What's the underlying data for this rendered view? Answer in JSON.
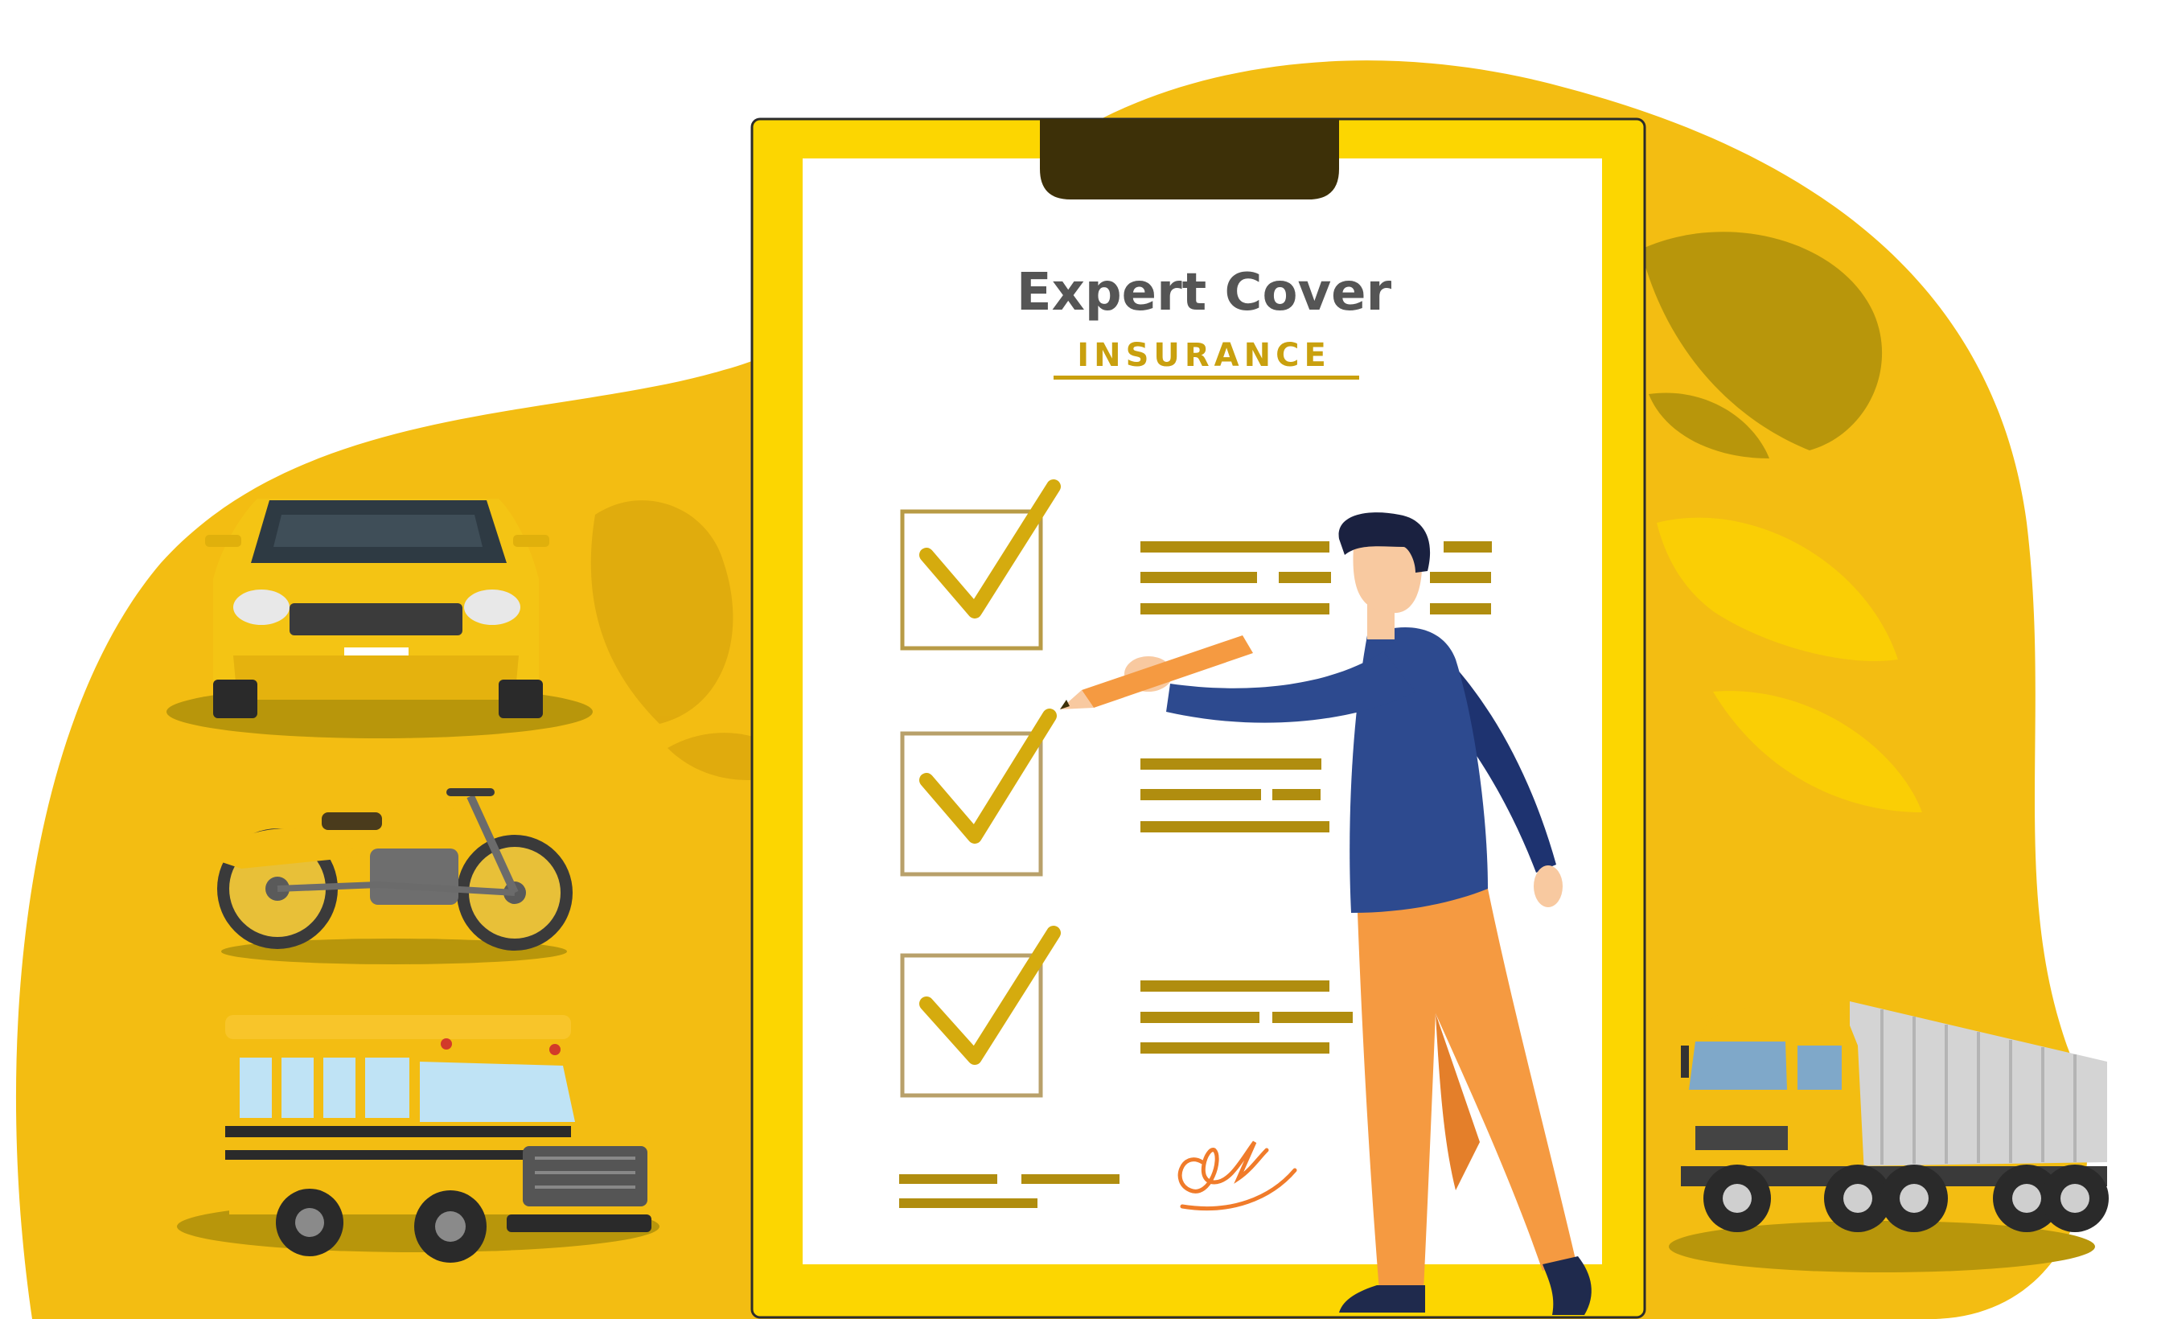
{
  "document": {
    "title": "Expert Cover",
    "subtitle": "INSURANCE"
  },
  "checklist": {
    "items": [
      {
        "checked": true
      },
      {
        "checked": true
      },
      {
        "checked": true
      }
    ]
  },
  "colors": {
    "background_blob": "#f3bd12",
    "leaf_shadow": "#b8960b",
    "clipboard_frame": "#fcd601",
    "clipboard_clip": "#3d3008",
    "paper": "#ffffff",
    "title_gray": "#555555",
    "accent_gold": "#c9a00e",
    "checkbox_stroke": "#b8a06a",
    "check_mark": "#d5ab0e",
    "text_lines": "#b08d0f",
    "signature_orange": "#f07b2a",
    "shirt_blue": "#2d4a8f",
    "pants_orange": "#f59a41",
    "skin": "#f8c9a0",
    "hair": "#1a2140"
  },
  "vehicles": [
    {
      "icon": "car-icon"
    },
    {
      "icon": "motorcycle-icon"
    },
    {
      "icon": "school-bus-icon"
    },
    {
      "icon": "truck-icon"
    }
  ],
  "figure": {
    "icon": "person-writing-icon"
  },
  "signature": {
    "icon": "signature-icon"
  }
}
